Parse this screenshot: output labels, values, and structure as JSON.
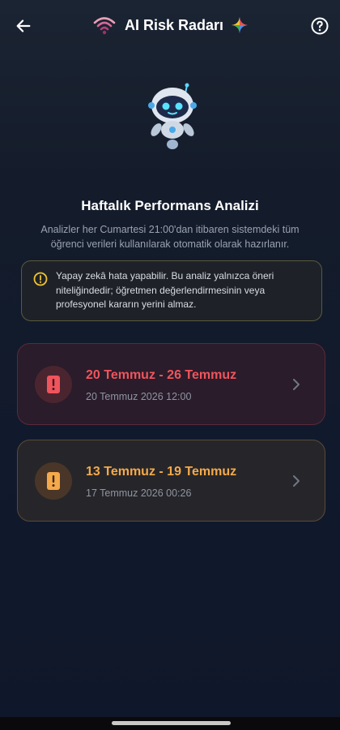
{
  "appbar": {
    "title": "AI Risk Radarı",
    "back_icon": "arrow-left-icon",
    "help_icon": "help-circle-icon",
    "wifi_icon": "wifi-icon",
    "sparkle_icon": "gemini-sparkle-icon"
  },
  "hero": {
    "illustration": "robot-mascot"
  },
  "section": {
    "title": "Haftalık Performans Analizi",
    "description": "Analizler her Cumartesi 21:00'dan itibaren sistemdeki tüm öğrenci verileri kullanılarak otomatik olarak hazırlanır."
  },
  "warning": {
    "icon": "info-icon",
    "text": "Yapay zekâ hata yapabilir. Bu analiz yalnızca öneri niteliğindedir; öğretmen değerlendirmesinin veya profesyonel kararın yerini almaz."
  },
  "reports": [
    {
      "title": "20 Temmuz - 26 Temmuz",
      "subtitle": "20 Temmuz 2026 12:00",
      "status_color": "#f0545c",
      "icon": "phone-alert-icon"
    },
    {
      "title": "13 Temmuz - 19 Temmuz",
      "subtitle": "17 Temmuz 2026 00:26",
      "status_color": "#f5a94a",
      "icon": "phone-alert-icon"
    }
  ]
}
